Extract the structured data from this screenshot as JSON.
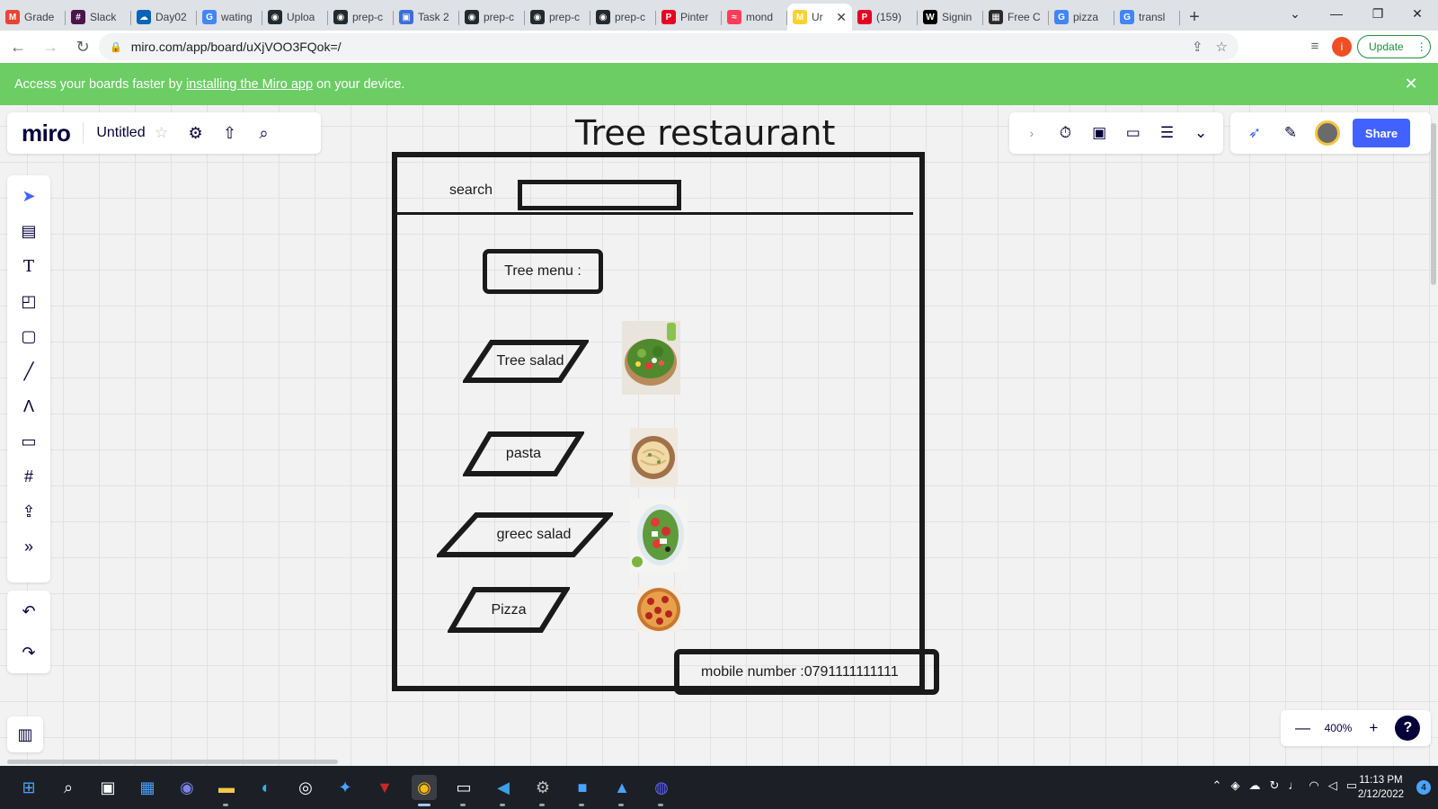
{
  "browser": {
    "tabs": [
      {
        "title": "Grade",
        "icon": "gmail-icon",
        "color": "#ea4335",
        "glyph": "M"
      },
      {
        "title": "Slack",
        "icon": "slack-icon",
        "color": "#4a154b",
        "glyph": "#"
      },
      {
        "title": "Day02",
        "icon": "onedrive-icon",
        "color": "#0364b8",
        "glyph": "☁"
      },
      {
        "title": "wating",
        "icon": "google-icon",
        "color": "#4285f4",
        "glyph": "G"
      },
      {
        "title": "Uploa",
        "icon": "github-icon",
        "color": "#24292e",
        "glyph": "◉"
      },
      {
        "title": "prep-c",
        "icon": "github-icon",
        "color": "#24292e",
        "glyph": "◉"
      },
      {
        "title": "Task 2",
        "icon": "task-icon",
        "color": "#3b6fd8",
        "glyph": "▣"
      },
      {
        "title": "prep-c",
        "icon": "github-icon",
        "color": "#24292e",
        "glyph": "◉"
      },
      {
        "title": "prep-c",
        "icon": "github-icon",
        "color": "#24292e",
        "glyph": "◉"
      },
      {
        "title": "prep-c",
        "icon": "github-icon",
        "color": "#24292e",
        "glyph": "◉"
      },
      {
        "title": "Pinter",
        "icon": "pinterest-icon",
        "color": "#e60023",
        "glyph": "P"
      },
      {
        "title": "mond",
        "icon": "monday-icon",
        "color": "#ff3d57",
        "glyph": "≈"
      },
      {
        "title": "Ur",
        "icon": "miro-icon",
        "color": "#ffd02f",
        "glyph": "M",
        "active": true
      },
      {
        "title": "(159)",
        "icon": "pinterest-icon",
        "color": "#e60023",
        "glyph": "P"
      },
      {
        "title": "Signin",
        "icon": "wix-icon",
        "color": "#000000",
        "glyph": "W"
      },
      {
        "title": "Free C",
        "icon": "image-icon",
        "color": "#2b2b2b",
        "glyph": "▦"
      },
      {
        "title": "pizza",
        "icon": "google-icon",
        "color": "#4285f4",
        "glyph": "G"
      },
      {
        "title": "transl",
        "icon": "google-icon",
        "color": "#4285f4",
        "glyph": "G"
      }
    ],
    "url": "miro.com/app/board/uXjVOO3FQok=/",
    "update_label": "Update",
    "profile_initial": "i"
  },
  "banner": {
    "prefix": "Access your boards faster by ",
    "link": "installing the Miro app",
    "suffix": " on your device."
  },
  "miro": {
    "logo": "miro",
    "board_name": "Untitled",
    "share_label": "Share",
    "zoom": "400%"
  },
  "wireframe": {
    "title": "Tree restaurant",
    "search_label": "search",
    "menu_label": "Tree menu :",
    "items": [
      {
        "label": "Tree salad",
        "image": "salad"
      },
      {
        "label": "pasta",
        "image": "pasta"
      },
      {
        "label": "greec salad",
        "image": "greek-salad"
      },
      {
        "label": "Pizza",
        "image": "pizza"
      }
    ],
    "mobile": "mobile number :0791111111111"
  },
  "taskbar": {
    "time": "11:13 PM",
    "date": "2/12/2022",
    "notifications": "4"
  },
  "colors": {
    "banner": "#6bcd64",
    "share": "#4262ff",
    "miro_dark": "#050038"
  }
}
